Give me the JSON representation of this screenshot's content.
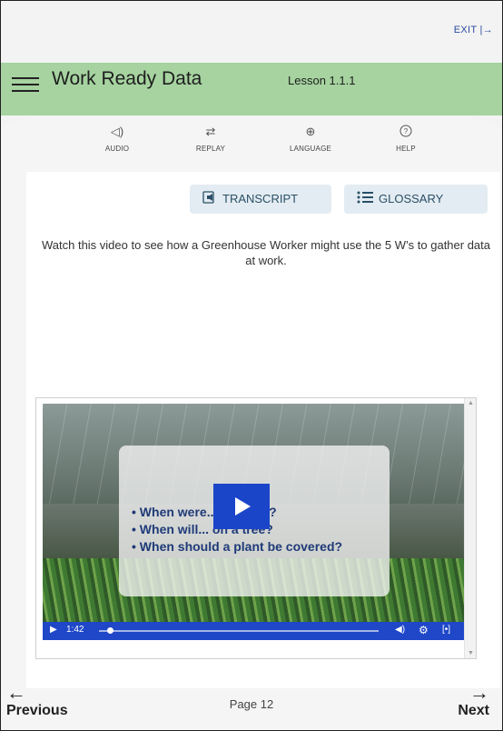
{
  "topbar": {
    "exit_label": "EXIT |→"
  },
  "header": {
    "title": "Work Ready Data",
    "lesson": "Lesson 1.1.1"
  },
  "tools": [
    {
      "icon": "speaker-icon",
      "glyph": "◁)",
      "label": "AUDIO"
    },
    {
      "icon": "replay-icon",
      "glyph": "⇄",
      "label": "REPLAY"
    },
    {
      "icon": "globe-icon",
      "glyph": "⊕",
      "label": "LANGUAGE"
    },
    {
      "icon": "help-icon",
      "glyph": "?",
      "label": "HELP"
    }
  ],
  "pills": {
    "transcript": "TRANSCRIPT",
    "glossary": "GLOSSARY"
  },
  "instructions": "Watch this video to see how a Greenhouse Worker might use the 5 W’s to gather data at work.",
  "video": {
    "bullets": [
      "When were... watered?",
      "When will... on a tree?",
      "When should a plant be covered?"
    ],
    "time": "1:42",
    "progress": 0.04
  },
  "footer": {
    "previous": "Previous",
    "next": "Next",
    "page": "Page 12"
  },
  "colors": {
    "header": "#a6d3a0",
    "video_controls": "#1f47c8",
    "exit": "#2b4aa0"
  }
}
